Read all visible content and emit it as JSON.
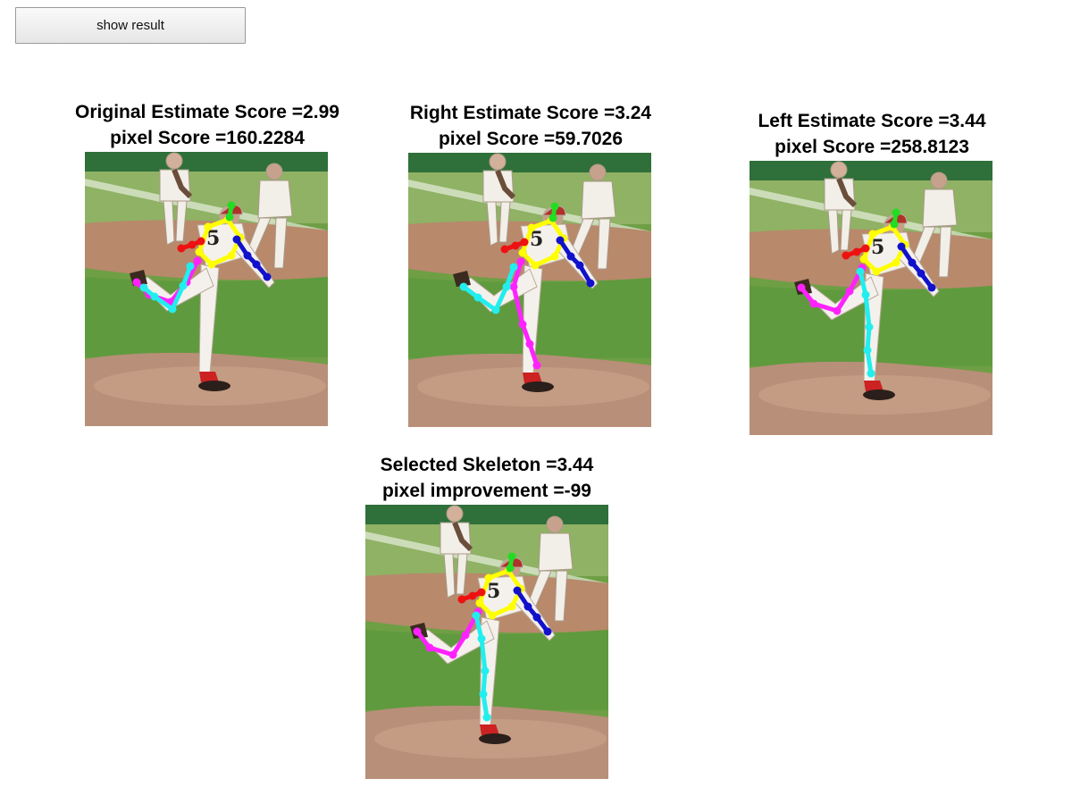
{
  "toolbar": {
    "show_result_label": "show result"
  },
  "panels": [
    {
      "line1": "Original Estimate Score =2.99",
      "line2": "pixel Score =160.2284",
      "variant": "original"
    },
    {
      "line1": "Right Estimate Score =3.24",
      "line2": "pixel Score =59.7026",
      "variant": "right"
    },
    {
      "line1": "Left Estimate Score =3.44",
      "line2": "pixel Score =258.8123",
      "variant": "left"
    },
    {
      "line1": "Selected Skeleton =3.44",
      "line2": "pixel improvement =-99",
      "variant": "left"
    }
  ],
  "skeleton_colors": {
    "head": "#22dd22",
    "torso": "#ffff00",
    "right_arm": "#ee1111",
    "left_arm": "#1111cc",
    "leg_a": "#ff22ff",
    "leg_b": "#22eeee"
  }
}
